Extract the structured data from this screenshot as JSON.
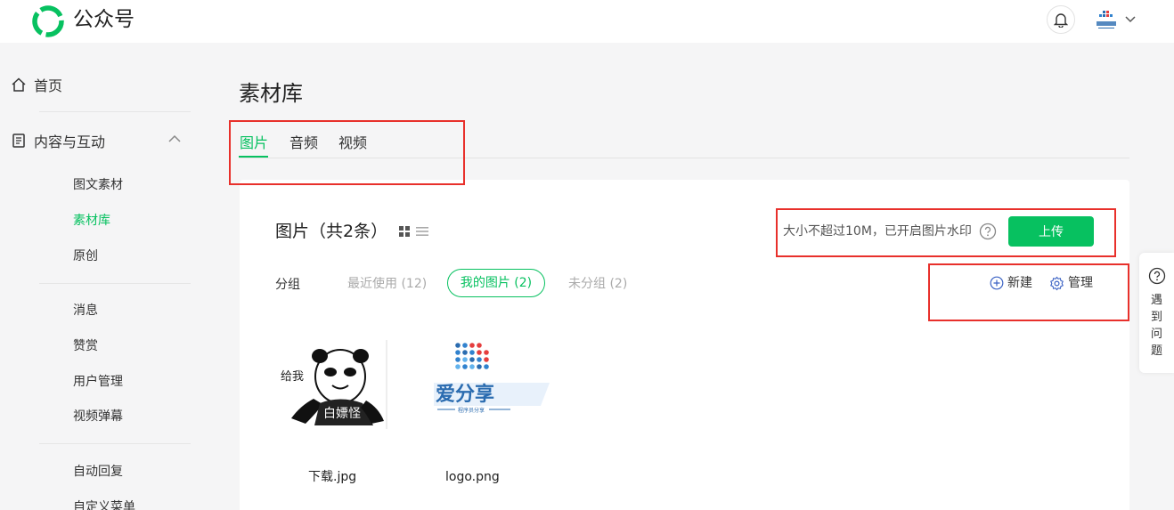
{
  "header": {
    "app_title": "公众号",
    "logo_icon": "wechat-mp-logo-icon",
    "bell_icon": "bell-icon",
    "avatar_icon": "account-avatar",
    "dropdown_icon": "chevron-down-icon"
  },
  "sidebar": {
    "home": "首页",
    "content_section": "内容与互动",
    "items": [
      "图文素材",
      "素材库",
      "原创",
      "消息",
      "赞赏",
      "用户管理",
      "视频弹幕",
      "自动回复",
      "自定义菜单"
    ],
    "active_index": 1
  },
  "main": {
    "page_title": "素材库",
    "tabs": [
      "图片",
      "音频",
      "视频"
    ],
    "active_tab": 0
  },
  "panel": {
    "title": "图片（共2条）",
    "hint": "大小不超过10M，已开启图片水印",
    "upload_label": "上传",
    "group_label": "分组",
    "groups": [
      "最近使用 (12)",
      "我的图片 (2)",
      "未分组 (2)"
    ],
    "new_label": "新建",
    "manage_label": "管理"
  },
  "files": [
    {
      "name": "下载.jpg",
      "caption_top": "给我",
      "caption_bottom": "白嫖怪"
    },
    {
      "name": "logo.png",
      "caption_top": "爱分享",
      "caption_bottom": "程序员分享"
    }
  ],
  "help": {
    "label": "遇到问题"
  },
  "colors": {
    "accent": "#07c160",
    "highlight": "#e8302b"
  }
}
